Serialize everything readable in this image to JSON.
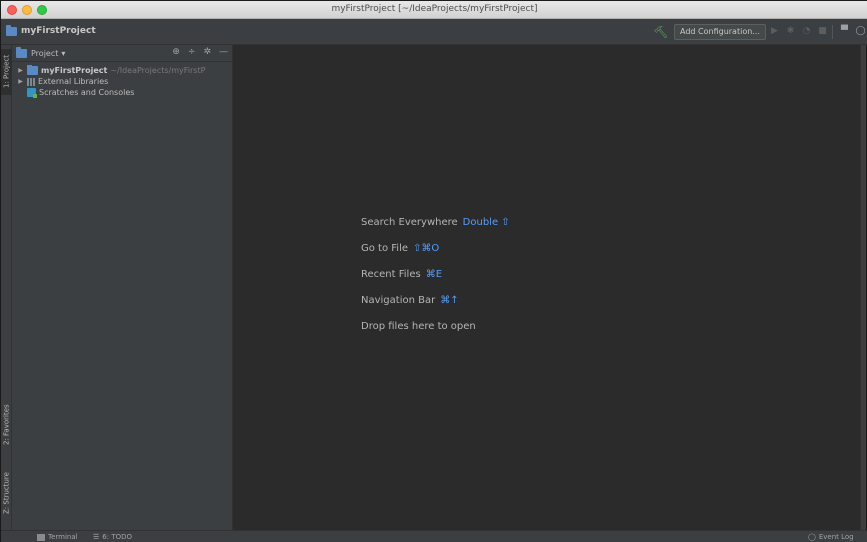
{
  "window": {
    "title": "myFirstProject [~/IdeaProjects/myFirstProject]"
  },
  "navbar": {
    "project_name": "myFirstProject",
    "add_configuration": "Add Configuration..."
  },
  "left_strip": {
    "project_tab": "1: Project",
    "favorites_tab": "2: Favorites",
    "structure_tab": "Z: Structure"
  },
  "panel": {
    "header_label": "Project",
    "header_dropdown": "▾",
    "tree": [
      {
        "label": "myFirstProject",
        "path": "~/IdeaProjects/myFirstP"
      },
      {
        "label": "External Libraries"
      },
      {
        "label": "Scratches and Consoles"
      }
    ]
  },
  "editor": {
    "hints": [
      {
        "label": "Search Everywhere",
        "shortcut": "Double ⇧"
      },
      {
        "label": "Go to File",
        "shortcut": "⇧⌘O"
      },
      {
        "label": "Recent Files",
        "shortcut": "⌘E"
      },
      {
        "label": "Navigation Bar",
        "shortcut": "⌘↑"
      },
      {
        "label": "Drop files here to open",
        "shortcut": ""
      }
    ]
  },
  "statusbar": {
    "terminal": "Terminal",
    "todo": "6: TODO",
    "event_log": "Event Log"
  },
  "colors": {
    "shortcut_blue": "#589df6",
    "panel_bg": "#3c3f41",
    "editor_bg": "#2b2b2b",
    "hammer_green": "#59a869"
  }
}
